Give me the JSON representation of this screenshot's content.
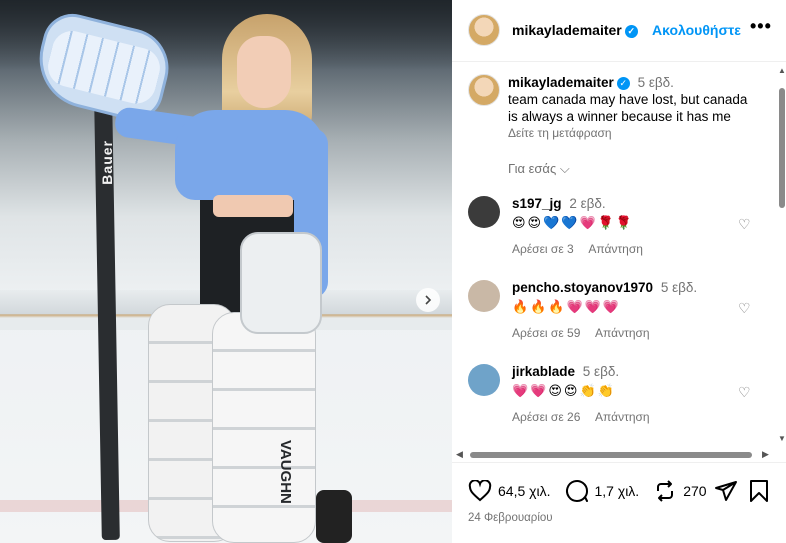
{
  "post": {
    "username": "mikaylademaiter",
    "follow_label": "Ακολουθήστε",
    "more_label": "•••",
    "caption_time": "5 εβδ.",
    "caption": "team canada may have lost, but canada is always a winner because it has me",
    "translate_label": "Δείτε τη μετάφραση",
    "for_you_label": "Για εσάς ⌵",
    "photo_text": {
      "stick": "Bauer",
      "pads": "VAUGHN"
    }
  },
  "comments": [
    {
      "username": "s197_jg",
      "time": "2 εβδ.",
      "emojis": "😍😍💙💙💗🌹🌹",
      "likes_label": "Αρέσει σε 3",
      "reply_label": "Απάντηση",
      "avatar_color": "#3b3b3b"
    },
    {
      "username": "pencho.stoyanov1970",
      "time": "5 εβδ.",
      "emojis": "🔥🔥🔥💗💗💗",
      "likes_label": "Αρέσει σε 59",
      "reply_label": "Απάντηση",
      "avatar_color": "#c9b8a6"
    },
    {
      "username": "jirkablade",
      "time": "5 εβδ.",
      "emojis": "💗💗😍😍👏👏",
      "likes_label": "Αρέσει σε 26",
      "reply_label": "Απάντηση",
      "avatar_color": "#6fa3c9"
    }
  ],
  "footer": {
    "likes": "64,5 χιλ.",
    "comments": "1,7 χιλ.",
    "reposts": "270",
    "date": "24 Φεβρουαρίου"
  },
  "colors": {
    "accent": "#0095f6",
    "secondary_text": "#737373",
    "heart_emoji": "#e0245e"
  }
}
